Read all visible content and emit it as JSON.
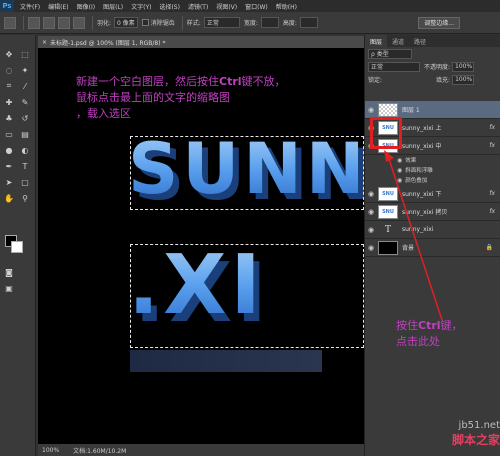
{
  "app": {
    "logo": "Ps"
  },
  "menu": [
    "文件(F)",
    "编辑(E)",
    "图像(I)",
    "图层(L)",
    "文字(Y)",
    "选择(S)",
    "滤镜(T)",
    "视图(V)",
    "窗口(W)",
    "帮助(H)"
  ],
  "options": {
    "feather_label": "羽化:",
    "feather_value": "0 像素",
    "antialias_label": "消除锯齿",
    "style_label": "样式:",
    "style_value": "正常",
    "width_label": "宽度:",
    "height_label": "高度:",
    "refine_button": "调整边缘..."
  },
  "document": {
    "tab_title": "未标题-1.psd @ 100% (图层 1, RGB/8) *",
    "zoom": "100%",
    "doc_size": "文档:1.60M/10.2M",
    "annotation_line1_pre": "新建一个空白图层，然后按住",
    "annotation_line1_key": "Ctrl",
    "annotation_line1_post": "键不放，",
    "annotation_line2": "鼠标点击最上面的文字的缩略图",
    "annotation_line3": "，载入选区",
    "big_text_1": "SUNN",
    "big_text_2": ".XI"
  },
  "panel": {
    "tabs": [
      "图层",
      "通道",
      "路径"
    ],
    "filter_label": "ρ 类型",
    "blend_mode": "正常",
    "opacity_label": "不透明度:",
    "opacity_value": "100%",
    "lock_label": "锁定:",
    "fill_label": "填充:",
    "fill_value": "100%",
    "layers": [
      {
        "name": "图层 1",
        "thumb": "checker",
        "selected": true,
        "fx": false
      },
      {
        "name": "sunny_xixi 上",
        "thumb": "text",
        "selected": false,
        "fx": true
      },
      {
        "name": "sunny_xixi 中",
        "thumb": "text",
        "selected": false,
        "fx": true
      },
      {
        "name": "sunny_xixi 下",
        "thumb": "text",
        "selected": false,
        "fx": true
      },
      {
        "name": "sunny_xixi 拷贝",
        "thumb": "text",
        "selected": false,
        "fx": true
      },
      {
        "name": "sunny_xixi",
        "thumb": "T",
        "selected": false,
        "fx": false
      },
      {
        "name": "背景",
        "thumb": "black",
        "selected": false,
        "fx": false
      }
    ],
    "sub_effects": [
      "效果",
      "斜面和浮雕",
      "颜色叠加"
    ]
  },
  "callout": {
    "line1_pre": "按住",
    "line1_key": "Ctrl",
    "line1_post": "键，",
    "line2": "点击此处"
  },
  "watermark": {
    "url": "jb51.net",
    "name": "脚本之家"
  },
  "colors": {
    "annotation": "#c040c0",
    "highlight": "#e02020"
  }
}
